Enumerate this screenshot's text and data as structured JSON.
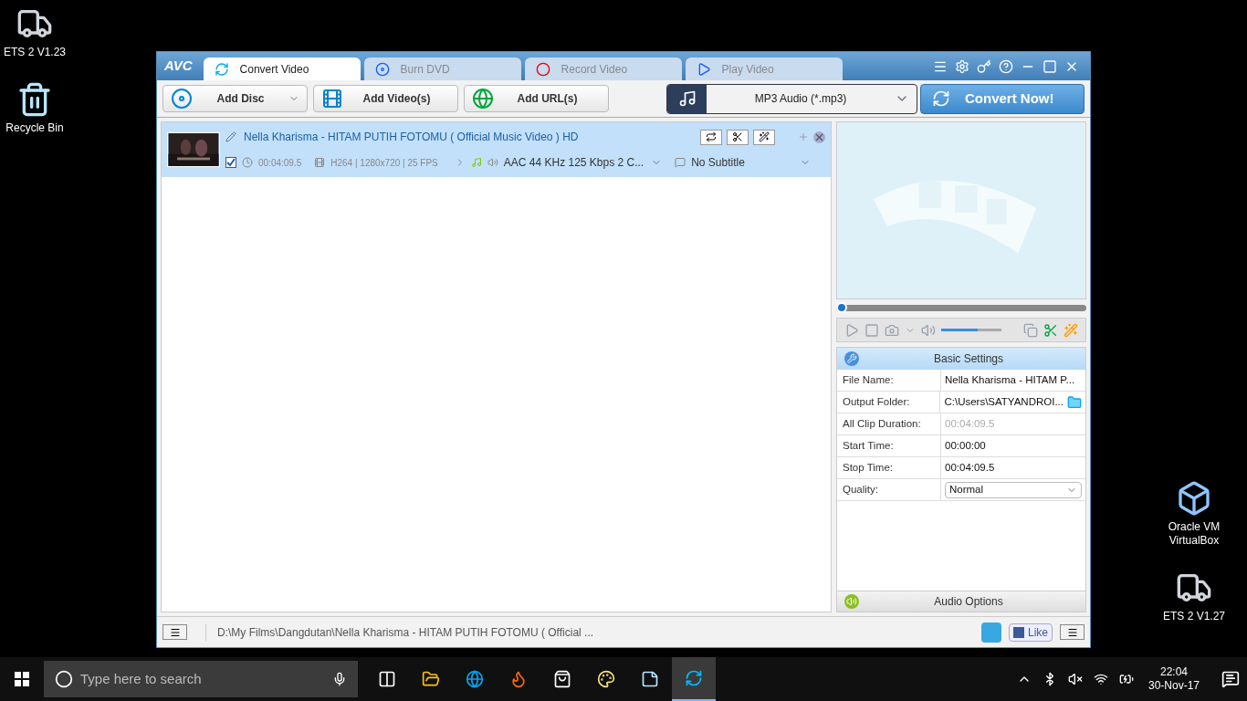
{
  "desktop_left": [
    {
      "label": "ETS 2 V1.23",
      "kind": "truck"
    },
    {
      "label": "Recycle Bin",
      "kind": "bin"
    }
  ],
  "desktop_right": [
    {
      "label": "Oracle VM VirtualBox",
      "kind": "vbox"
    },
    {
      "label": "ETS 2 V1.27",
      "kind": "truck"
    }
  ],
  "window": {
    "logo": "AVC",
    "tabs": [
      {
        "label": "Convert Video",
        "kind": "convert",
        "selected": true
      },
      {
        "label": "Burn DVD",
        "kind": "dvd",
        "selected": false
      },
      {
        "label": "Record Video",
        "kind": "record",
        "selected": false
      },
      {
        "label": "Play Video",
        "kind": "play",
        "selected": false
      }
    ],
    "toolbar": [
      {
        "label": "Add Disc",
        "kind": "disc",
        "dropdown": true
      },
      {
        "label": "Add Video(s)",
        "kind": "video",
        "dropdown": false
      },
      {
        "label": "Add URL(s)",
        "kind": "url",
        "dropdown": false
      }
    ],
    "format": "MP3 Audio (*.mp3)",
    "convert": "Convert Now!",
    "files": [
      {
        "title": "Nella Kharisma - HITAM PUTIH FOTOMU ( Official Music Video )  HD",
        "selected": true,
        "checked": true,
        "duration": "00:04:09.5",
        "video_info": "H264 | 1280x720 | 25 FPS",
        "audio": "AAC 44 KHz 125 Kbps 2 C...",
        "subtitle": "No Subtitle"
      }
    ],
    "player": {
      "seek": {
        "level": 0
      },
      "volume": {
        "level": 0.6
      }
    },
    "settings": {
      "title": "Basic Settings",
      "rows": [
        {
          "label": "File Name:",
          "value": "Nella Kharisma - HITAM P...",
          "kind": "text"
        },
        {
          "label": "Output Folder:",
          "value": "C:\\Users\\SATYANDROI...",
          "kind": "folder"
        },
        {
          "label": "All Clip Duration:",
          "value": "00:04:09.5",
          "kind": "disabled"
        },
        {
          "label": "Start Time:",
          "value": "00:00:00",
          "kind": "text"
        },
        {
          "label": "Stop Time:",
          "value": "00:04:09.5",
          "kind": "text"
        },
        {
          "label": "Quality:",
          "value": "Normal",
          "kind": "select"
        }
      ],
      "audio_options": "Audio Options"
    },
    "status_bar": {
      "path": "D:\\My Films\\Dangdutan\\Nella Kharisma - HITAM PUTIH FOTOMU ( Official ...",
      "like": "Like"
    }
  },
  "taskbar": {
    "search": {
      "placeholder": "Type here to search"
    },
    "apps": [
      {
        "kind": "taskview",
        "selected": false
      },
      {
        "kind": "explorer",
        "selected": false
      },
      {
        "kind": "edge",
        "selected": false
      },
      {
        "kind": "firefox",
        "selected": false
      },
      {
        "kind": "store",
        "selected": false
      },
      {
        "kind": "paint",
        "selected": false
      },
      {
        "kind": "notes",
        "selected": false
      },
      {
        "kind": "avc",
        "selected": true
      }
    ],
    "time": "22:04",
    "date": "30-Nov-17"
  }
}
